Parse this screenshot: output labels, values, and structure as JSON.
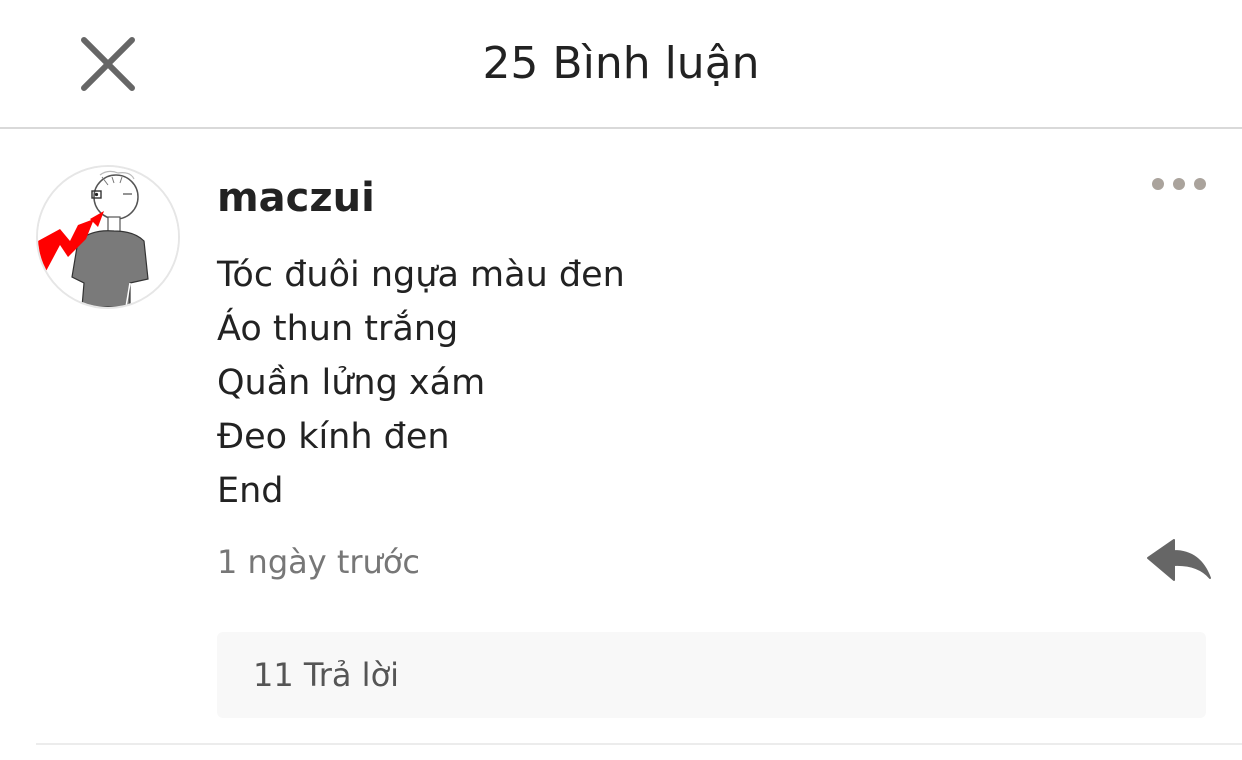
{
  "header": {
    "title": "25 Bình luận",
    "close_icon": "close-icon"
  },
  "comment": {
    "username": "maczui",
    "avatar": "user-avatar",
    "lines": [
      "Tóc đuôi ngựa màu đen",
      "Áo thun trắng",
      "Quần lửng xám",
      "Đeo kính đen",
      "End"
    ],
    "timestamp": "1 ngày trước",
    "more_icon": "more-horizontal-icon",
    "reply_icon": "reply-arrow-icon",
    "replies_label": "11 Trả lời"
  },
  "colors": {
    "text": "#222222",
    "muted": "#777777",
    "icon": "#666666",
    "dots": "#aaa39c",
    "divider": "#d9d9d9",
    "reply_box": "#f8f8f8",
    "avatar_accent": "#ff0000"
  }
}
